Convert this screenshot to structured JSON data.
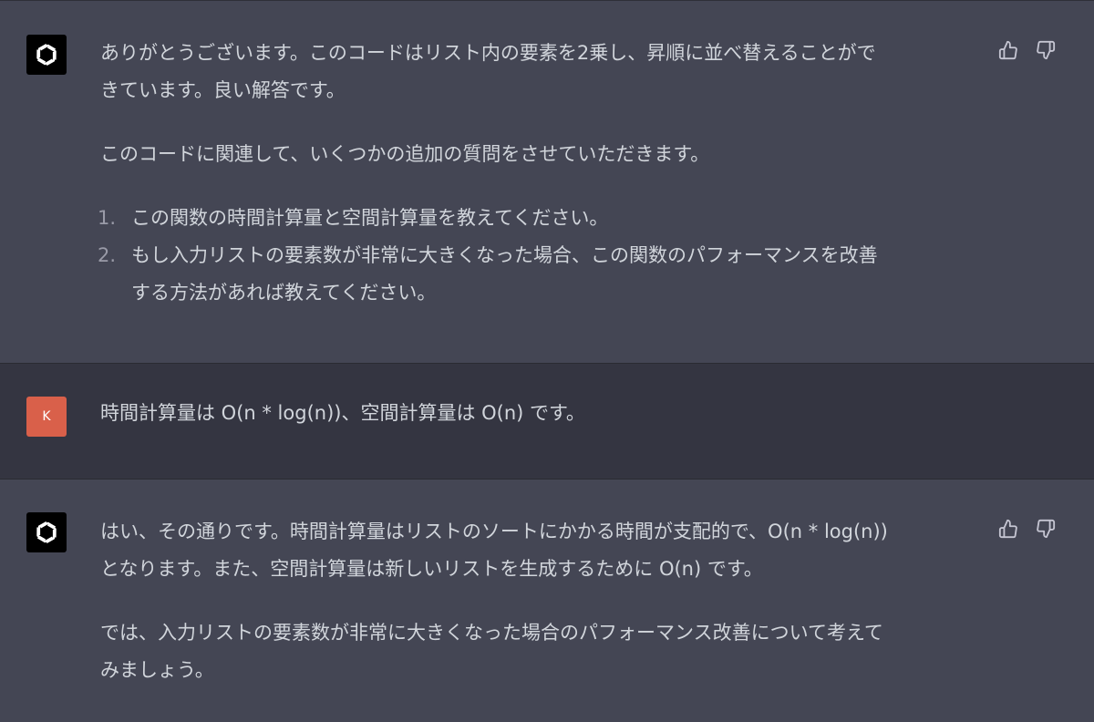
{
  "messages": [
    {
      "role": "assistant",
      "paragraph1": "ありがとうございます。このコードはリスト内の要素を2乗し、昇順に並べ替えることがで",
      "paragraph1b": "きています。良い解答です。",
      "paragraph2": "このコードに関連して、いくつかの追加の質問をさせていただきます。",
      "list": [
        {
          "num": "1.",
          "lines": [
            "この関数の時間計算量と空間計算量を教えてください。"
          ]
        },
        {
          "num": "2.",
          "lines": [
            "もし入力リストの要素数が非常に大きくなった場合、この関数のパフォーマンスを改善",
            "する方法があれば教えてください。"
          ]
        }
      ]
    },
    {
      "role": "user",
      "avatar_letter": "K",
      "text": "時間計算量は O(n * log(n))、空間計算量は O(n) です。"
    },
    {
      "role": "assistant",
      "paragraph1": "はい、その通りです。時間計算量はリストのソートにかかる時間が支配的で、O(n * log(n))",
      "paragraph1b": "となります。また、空間計算量は新しいリストを生成するために O(n) です。",
      "paragraph2": "では、入力リストの要素数が非常に大きくなった場合のパフォーマンス改善について考えて",
      "paragraph2b": "みましょう。"
    }
  ],
  "colors": {
    "assistant_bg": "#444654",
    "user_bg": "#343541",
    "user_avatar": "#d9604a",
    "text": "#d1d5db"
  },
  "icons": [
    "openai-logo-icon",
    "thumbs-up-icon",
    "thumbs-down-icon"
  ]
}
